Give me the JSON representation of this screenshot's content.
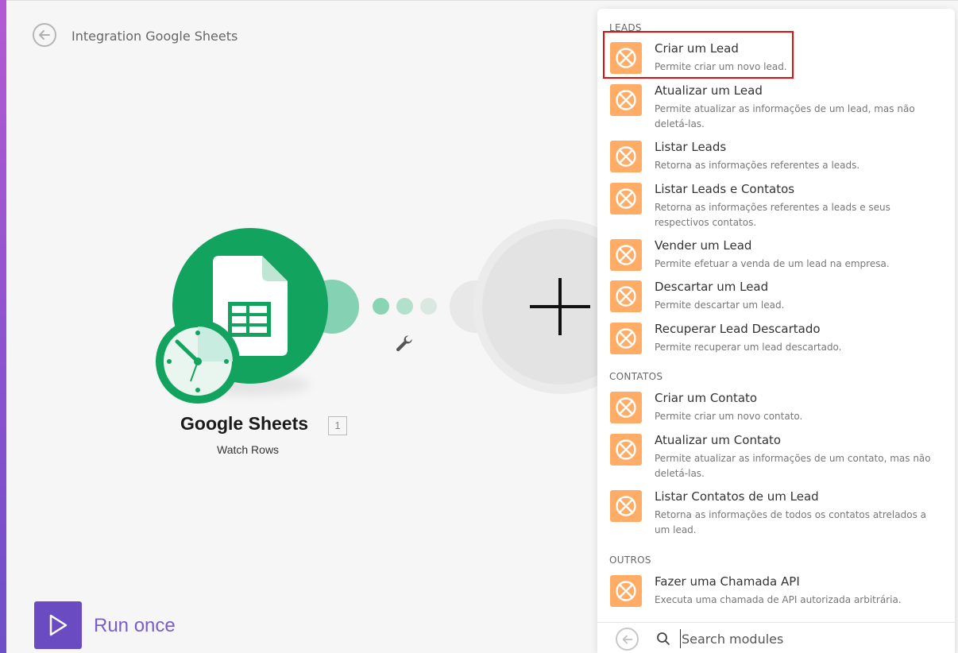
{
  "header": {
    "title": "Integration Google Sheets",
    "back_icon": "arrow-left-circle-icon"
  },
  "canvas": {
    "module": {
      "name": "Google Sheets",
      "badge": "1",
      "operation": "Watch Rows",
      "icon": "google-sheets-icon",
      "color": "#12a35f"
    },
    "add_module_icon": "plus-icon",
    "settings_icon": "wrench-icon"
  },
  "run": {
    "label": "Run once",
    "icon": "play-icon",
    "color": "#6a4bc2"
  },
  "panel": {
    "item_icon": "app-logo-icon",
    "accent": "#ffad66",
    "sections": [
      {
        "label": "LEADS",
        "items": [
          {
            "title": "Criar um Lead",
            "desc": "Permite criar um novo lead."
          },
          {
            "title": "Atualizar um Lead",
            "desc": "Permite atualizar as informações de um lead, mas não deletá-las."
          },
          {
            "title": "Listar Leads",
            "desc": "Retorna as informações referentes a leads."
          },
          {
            "title": "Listar Leads e Contatos",
            "desc": "Retorna as informações referentes a leads e seus respectivos contatos."
          },
          {
            "title": "Vender um Lead",
            "desc": "Permite efetuar a venda de um lead na empresa."
          },
          {
            "title": "Descartar um Lead",
            "desc": "Permite descartar um lead."
          },
          {
            "title": "Recuperar Lead Descartado",
            "desc": "Permite recuperar um lead descartado."
          }
        ]
      },
      {
        "label": "CONTATOS",
        "items": [
          {
            "title": "Criar um Contato",
            "desc": "Permite criar um novo contato."
          },
          {
            "title": "Atualizar um Contato",
            "desc": "Permite atualizar as informações de um contato, mas não deletá-las."
          },
          {
            "title": "Listar Contatos de um Lead",
            "desc": "Retorna as informações de todos os contatos atrelados a um lead."
          }
        ]
      },
      {
        "label": "OUTROS",
        "items": [
          {
            "title": "Fazer uma Chamada API",
            "desc": "Executa uma chamada de API autorizada arbitrária."
          }
        ]
      }
    ],
    "search": {
      "placeholder": "Search modules",
      "value": ""
    }
  }
}
